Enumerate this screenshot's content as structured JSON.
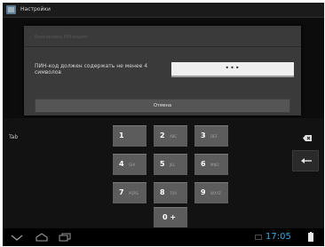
{
  "app": {
    "title": "Настройки"
  },
  "dialog": {
    "title": "Блокировка PIN-кодом",
    "message": "ПИН-код должен содержать не менее 4 символов",
    "pin_dots": "•••",
    "cancel_label": "Отмена"
  },
  "keyboard": {
    "tab_label": "Tab",
    "keys": [
      {
        "digit": "1",
        "letters": ""
      },
      {
        "digit": "2",
        "letters": "ABC"
      },
      {
        "digit": "3",
        "letters": "DEF"
      },
      {
        "digit": "4",
        "letters": "GHI"
      },
      {
        "digit": "5",
        "letters": "JKL"
      },
      {
        "digit": "6",
        "letters": "MNO"
      },
      {
        "digit": "7",
        "letters": "PQRS"
      },
      {
        "digit": "8",
        "letters": "TUV"
      },
      {
        "digit": "9",
        "letters": "WXYZ"
      },
      {
        "digit": "0 +",
        "letters": ""
      }
    ]
  },
  "system_bar": {
    "time": "17:05"
  },
  "colors": {
    "clock": "#3ba6d8",
    "key": "#5c5c5c",
    "dialog": "#3a3a3a"
  },
  "icons": [
    "app-settings-icon",
    "backspace-icon",
    "enter-icon",
    "back-icon",
    "home-icon",
    "recent-apps-icon",
    "keyboard-indicator-icon",
    "battery-icon"
  ]
}
